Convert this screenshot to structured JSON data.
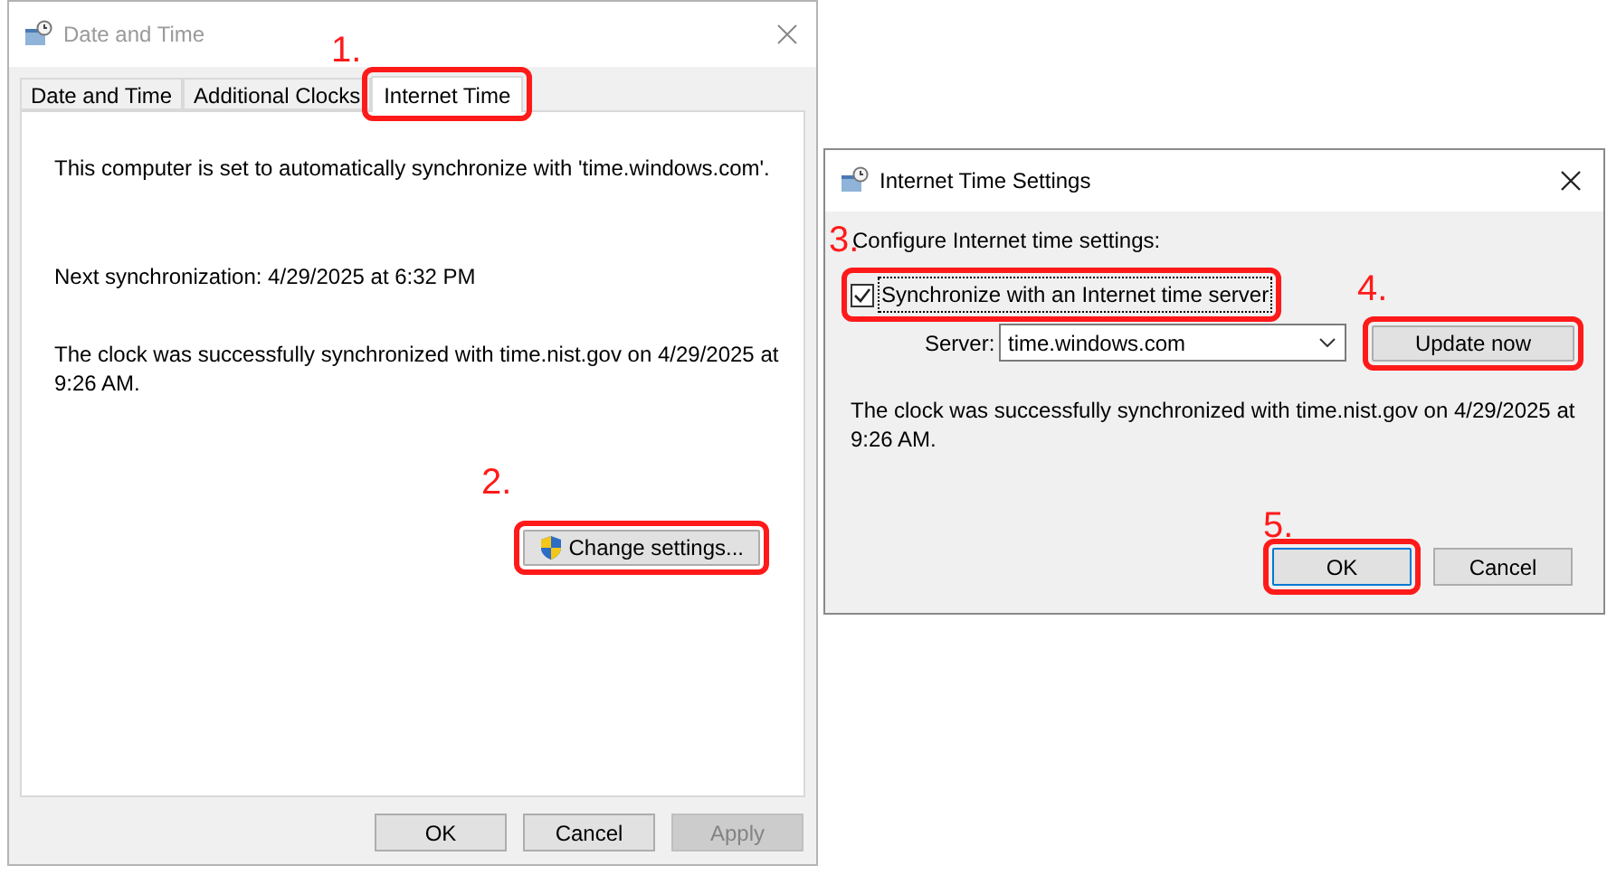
{
  "main_window": {
    "title": "Date and Time",
    "tabs": [
      {
        "label": "Date and Time",
        "selected": false,
        "highlighted": false
      },
      {
        "label": "Additional Clocks",
        "selected": false,
        "highlighted": false
      },
      {
        "label": "Internet Time",
        "selected": true,
        "highlighted": true,
        "step": "1."
      }
    ],
    "sync_text": "This computer is set to automatically synchronize with 'time.windows.com'.",
    "next_sync": "Next synchronization: 4/29/2025 at 6:32 PM",
    "status": "The clock was successfully synchronized with time.nist.gov on 4/29/2025 at 9:26 AM.",
    "change_button": {
      "label": "Change settings...",
      "highlighted": true,
      "step": "2."
    },
    "buttons": [
      {
        "label": "OK",
        "disabled": false
      },
      {
        "label": "Cancel",
        "disabled": false
      },
      {
        "label": "Apply",
        "disabled": true
      }
    ]
  },
  "dialog": {
    "title": "Internet Time Settings",
    "heading": "Configure Internet time settings:",
    "heading_step": "3.",
    "sync_checkbox": {
      "label": "Synchronize with an Internet time server",
      "checked": true,
      "highlighted": true
    },
    "server_label": "Server:",
    "server_value": "time.windows.com",
    "update_button": {
      "label": "Update now",
      "highlighted": true,
      "step": "4."
    },
    "status": "The clock was successfully synchronized with time.nist.gov on 4/29/2025 at 9:26 AM.",
    "buttons": [
      {
        "label": "OK",
        "highlighted": true,
        "default": true,
        "step": "5."
      },
      {
        "label": "Cancel",
        "highlighted": false,
        "default": false
      }
    ]
  }
}
